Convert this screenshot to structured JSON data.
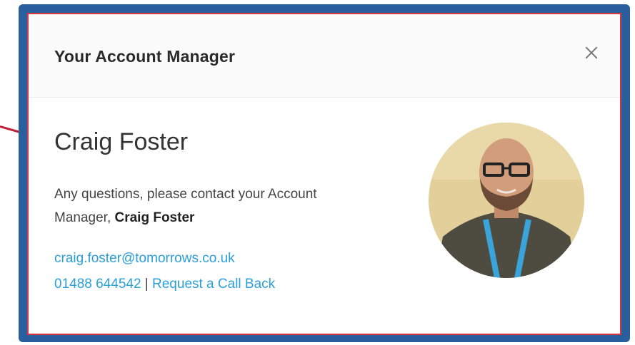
{
  "dialog": {
    "title": "Your Account Manager",
    "close_icon": "close-icon"
  },
  "manager": {
    "name": "Craig Foster",
    "message_prefix": "Any questions, please contact your Account Manager, ",
    "message_name": "Craig Foster",
    "email": "craig.foster@tomorrows.co.uk",
    "phone": "01488 644542",
    "separator": "|",
    "callback_label": "Request a Call Back",
    "avatar_icon": "avatar-photo"
  },
  "colors": {
    "link": "#2a9fd8",
    "frame": "#2a5f9e",
    "highlight_border": "#d9343f"
  }
}
